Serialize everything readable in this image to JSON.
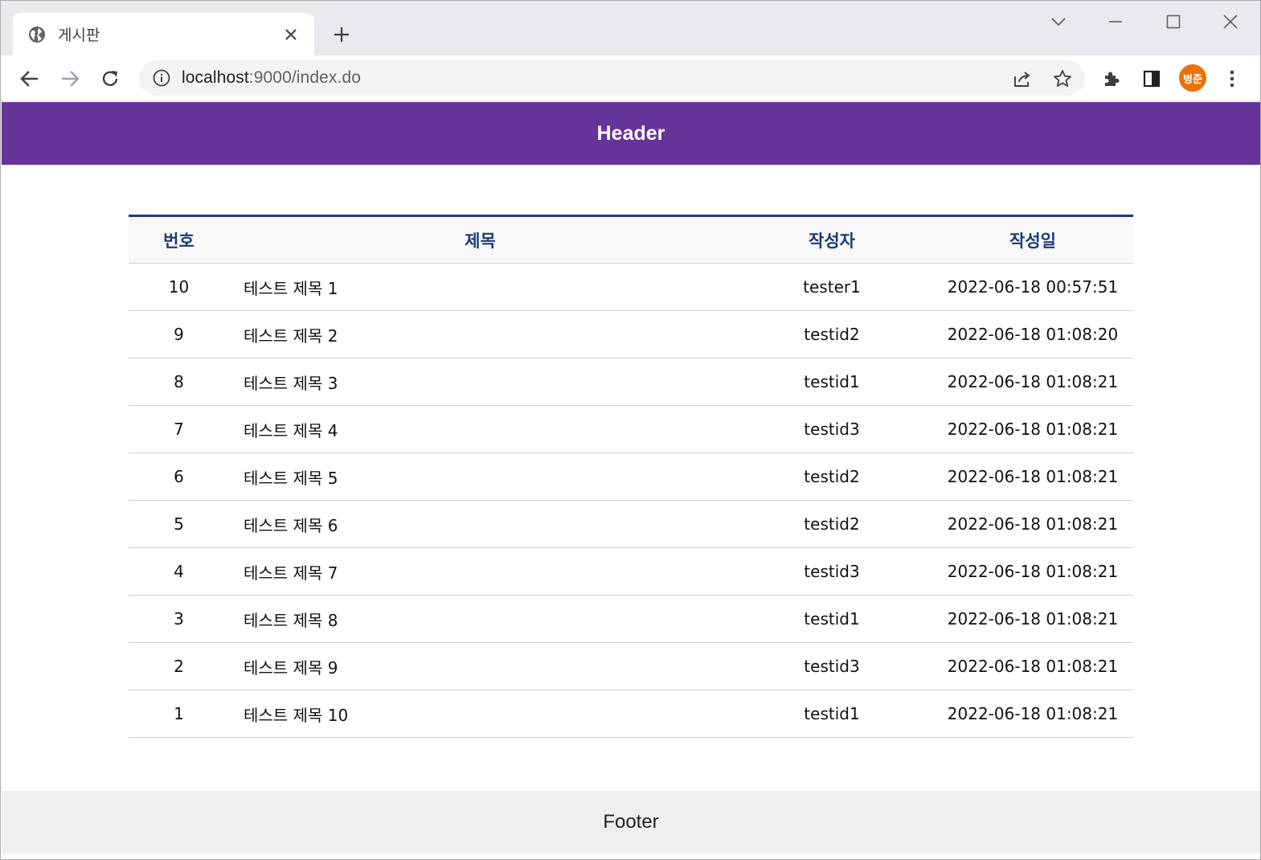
{
  "browser": {
    "tab": {
      "title": "게시판"
    },
    "url_host": "localhost",
    "url_rest": ":9000/index.do",
    "profile_initials": "병준"
  },
  "page": {
    "header": "Header",
    "footer": "Footer"
  },
  "board": {
    "headers": {
      "no": "번호",
      "title": "제목",
      "writer": "작성자",
      "date": "작성일"
    },
    "rows": [
      {
        "no": "10",
        "title": "테스트 제목 1",
        "writer": "tester1",
        "date": "2022-06-18 00:57:51"
      },
      {
        "no": "9",
        "title": "테스트 제목 2",
        "writer": "testid2",
        "date": "2022-06-18 01:08:20"
      },
      {
        "no": "8",
        "title": "테스트 제목 3",
        "writer": "testid1",
        "date": "2022-06-18 01:08:21"
      },
      {
        "no": "7",
        "title": "테스트 제목 4",
        "writer": "testid3",
        "date": "2022-06-18 01:08:21"
      },
      {
        "no": "6",
        "title": "테스트 제목 5",
        "writer": "testid2",
        "date": "2022-06-18 01:08:21"
      },
      {
        "no": "5",
        "title": "테스트 제목 6",
        "writer": "testid2",
        "date": "2022-06-18 01:08:21"
      },
      {
        "no": "4",
        "title": "테스트 제목 7",
        "writer": "testid3",
        "date": "2022-06-18 01:08:21"
      },
      {
        "no": "3",
        "title": "테스트 제목 8",
        "writer": "testid1",
        "date": "2022-06-18 01:08:21"
      },
      {
        "no": "2",
        "title": "테스트 제목 9",
        "writer": "testid3",
        "date": "2022-06-18 01:08:21"
      },
      {
        "no": "1",
        "title": "테스트 제목 10",
        "writer": "testid1",
        "date": "2022-06-18 01:08:21"
      }
    ]
  },
  "colors": {
    "header_bg": "#663399",
    "table_accent": "#1d3a78",
    "footer_bg": "#efefef",
    "avatar_bg": "#e8710a"
  }
}
